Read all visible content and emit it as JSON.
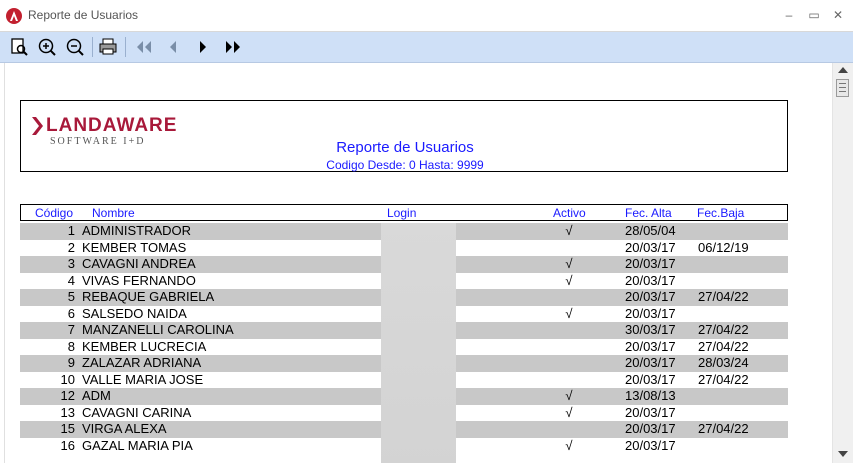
{
  "window": {
    "title": "Reporte de Usuarios",
    "minimize": "–",
    "maximize": "▭",
    "close": "✕"
  },
  "toolbar": {
    "buttons": [
      "page-preview-icon",
      "zoom-in-icon",
      "zoom-out-icon",
      "printer-icon",
      "first-page-icon",
      "previous-page-icon",
      "next-page-icon",
      "last-page-icon"
    ]
  },
  "report": {
    "logo": {
      "name": "LANDAWARE",
      "tagline": "SOFTWARE I+D"
    },
    "title": "Reporte de Usuarios",
    "subtitle": "Codigo Desde: 0 Hasta: 9999"
  },
  "table": {
    "columns": {
      "code": "Código",
      "name": "Nombre",
      "login": "Login",
      "active": "Activo",
      "alta": "Fec. Alta",
      "baja": "Fec.Baja"
    },
    "rows": [
      {
        "code": "1",
        "name": "ADMINISTRADOR",
        "active": "√",
        "alta": "28/05/04",
        "baja": ""
      },
      {
        "code": "2",
        "name": "KEMBER TOMAS",
        "active": "",
        "alta": "20/03/17",
        "baja": "06/12/19"
      },
      {
        "code": "3",
        "name": "CAVAGNI ANDREA",
        "active": "√",
        "alta": "20/03/17",
        "baja": ""
      },
      {
        "code": "4",
        "name": "VIVAS FERNANDO",
        "active": "√",
        "alta": "20/03/17",
        "baja": ""
      },
      {
        "code": "5",
        "name": "REBAQUE GABRIELA",
        "active": "",
        "alta": "20/03/17",
        "baja": "27/04/22"
      },
      {
        "code": "6",
        "name": "SALSEDO NAIDA",
        "active": "√",
        "alta": "20/03/17",
        "baja": ""
      },
      {
        "code": "7",
        "name": "MANZANELLI CAROLINA",
        "active": "",
        "alta": "30/03/17",
        "baja": "27/04/22"
      },
      {
        "code": "8",
        "name": "KEMBER LUCRECIA",
        "active": "",
        "alta": "20/03/17",
        "baja": "27/04/22"
      },
      {
        "code": "9",
        "name": "ZALAZAR ADRIANA",
        "active": "",
        "alta": "20/03/17",
        "baja": "28/03/24"
      },
      {
        "code": "10",
        "name": "VALLE MARIA JOSE",
        "active": "",
        "alta": "20/03/17",
        "baja": "27/04/22"
      },
      {
        "code": "12",
        "name": "ADM",
        "active": "√",
        "alta": "13/08/13",
        "baja": ""
      },
      {
        "code": "13",
        "name": "CAVAGNI CARINA",
        "active": "√",
        "alta": "20/03/17",
        "baja": ""
      },
      {
        "code": "15",
        "name": "VIRGA ALEXA",
        "active": "",
        "alta": "20/03/17",
        "baja": "27/04/22"
      },
      {
        "code": "16",
        "name": "GAZAL MARIA PIA",
        "active": "√",
        "alta": "20/03/17",
        "baja": ""
      }
    ]
  }
}
